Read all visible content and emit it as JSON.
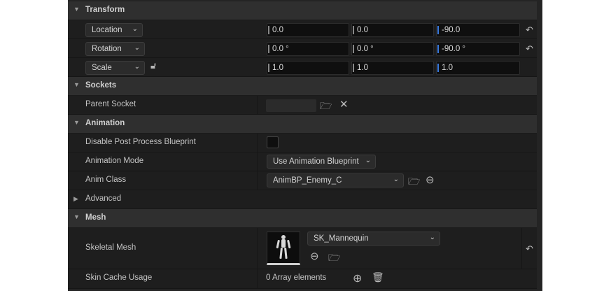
{
  "sections": {
    "transform": "Transform",
    "sockets": "Sockets",
    "animation": "Animation",
    "advanced": "Advanced",
    "mesh": "Mesh"
  },
  "transform": {
    "location": {
      "label": "Location",
      "x": "0.0",
      "y": "0.0",
      "z": "-90.0"
    },
    "rotation": {
      "label": "Rotation",
      "x": "0.0 °",
      "y": "0.0 °",
      "z": "-90.0 °"
    },
    "scale": {
      "label": "Scale",
      "x": "1.0",
      "y": "1.0",
      "z": "1.0"
    }
  },
  "sockets": {
    "parent_socket_label": "Parent Socket"
  },
  "animation": {
    "disable_post_label": "Disable Post Process Blueprint",
    "mode_label": "Animation Mode",
    "mode_value": "Use Animation Blueprint",
    "anim_class_label": "Anim Class",
    "anim_class_value": "AnimBP_Enemy_C"
  },
  "mesh": {
    "skeletal_mesh_label": "Skeletal Mesh",
    "skeletal_mesh_value": "SK_Mannequin",
    "skin_cache_label": "Skin Cache Usage",
    "skin_cache_value": "0 Array elements"
  },
  "icons": [
    "reset-icon",
    "lock-icon",
    "browse-icon",
    "clear-icon",
    "use-selected-icon",
    "add-icon",
    "trash-icon",
    "chevron-down-icon"
  ]
}
